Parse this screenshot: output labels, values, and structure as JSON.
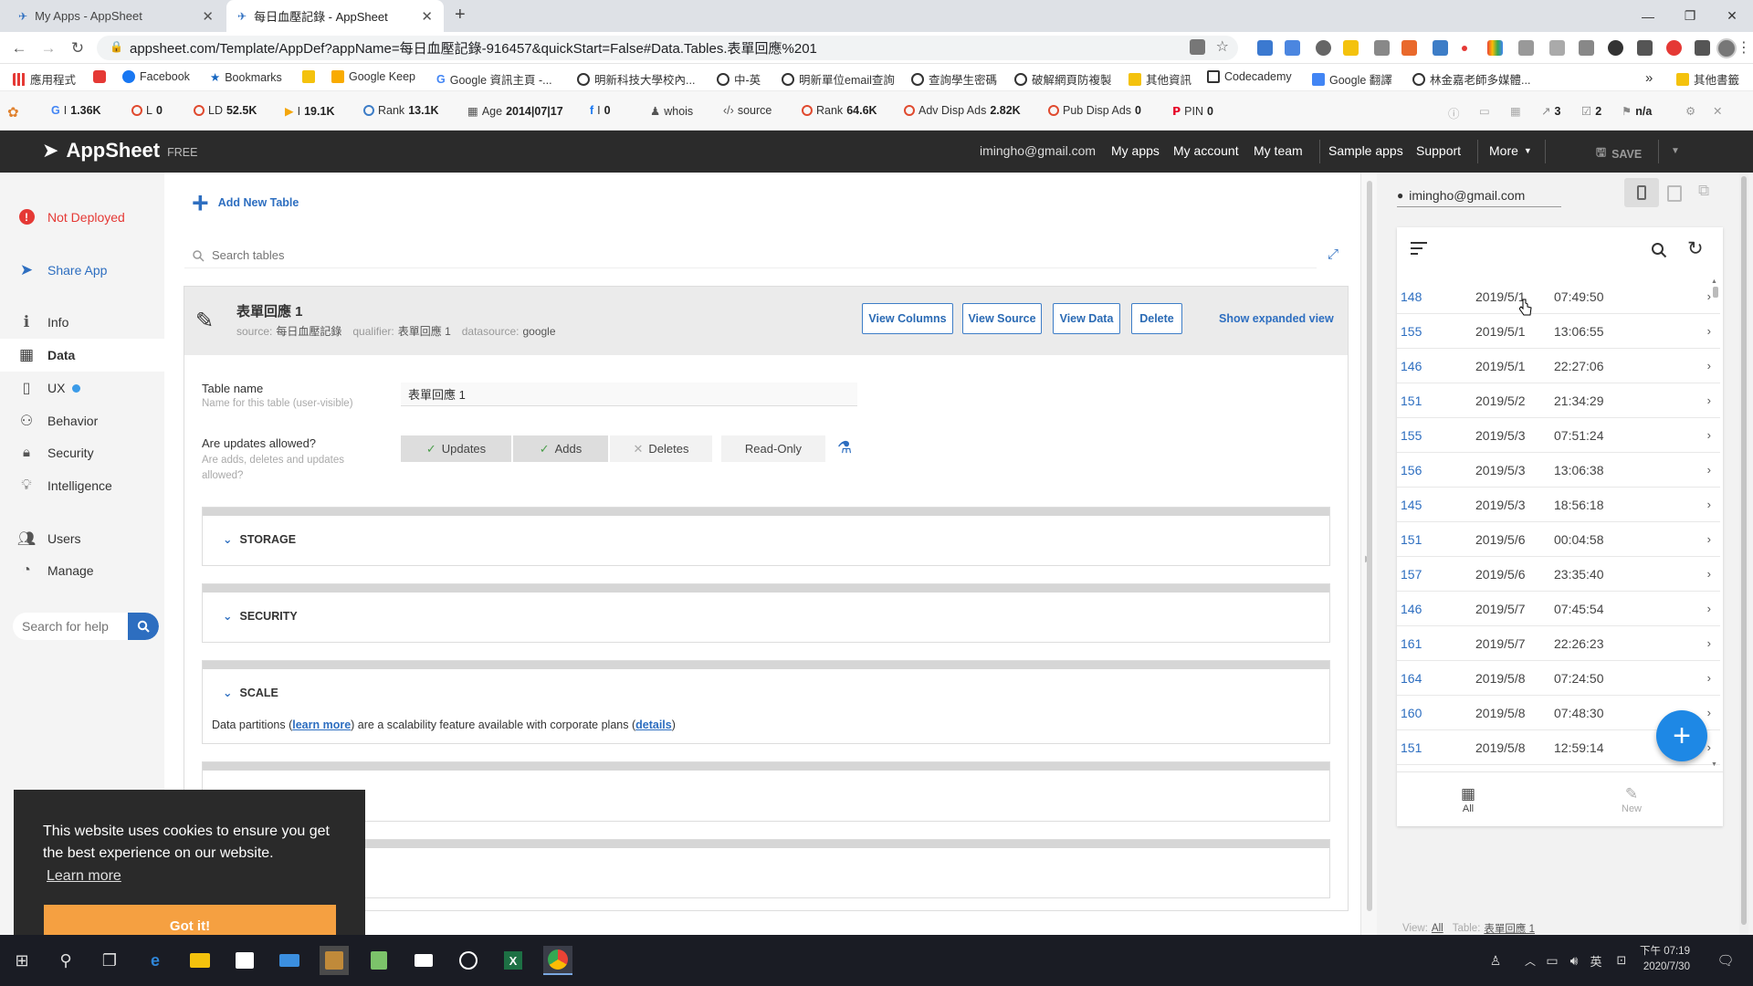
{
  "browser": {
    "tabs": [
      {
        "title": "My Apps - AppSheet",
        "active": false
      },
      {
        "title": "每日血壓記錄 - AppSheet",
        "active": true
      }
    ],
    "new_tab": "+",
    "url": "appsheet.com/Template/AppDef?appName=每日血壓記錄-916457&quickStart=False#Data.Tables.表單回應%201"
  },
  "bookmarks": [
    {
      "label": "應用程式",
      "icon": "apps-icon"
    },
    {
      "label": "",
      "icon": "youtube-icon"
    },
    {
      "label": "Facebook",
      "icon": "facebook-icon"
    },
    {
      "label": "Bookmarks",
      "icon": "star-icon"
    },
    {
      "label": "",
      "icon": "bookmark-yellow-icon"
    },
    {
      "label": "Google Keep",
      "icon": "keep-icon"
    },
    {
      "label": "Google 資訊主頁 -...",
      "icon": "google-icon"
    },
    {
      "label": "明新科技大學校內...",
      "icon": "globe-icon"
    },
    {
      "label": "中-英",
      "icon": "globe-icon"
    },
    {
      "label": "明新單位email查詢",
      "icon": "globe-icon"
    },
    {
      "label": "查詢學生密碼",
      "icon": "globe-icon"
    },
    {
      "label": "破解網頁防複製",
      "icon": "globe-icon"
    },
    {
      "label": "其他資訊",
      "icon": "folder-icon"
    },
    {
      "label": "Codecademy",
      "icon": "codecademy-icon"
    },
    {
      "label": "Google 翻譯",
      "icon": "translate-icon"
    },
    {
      "label": "林金嘉老師多媒體...",
      "icon": "globe-icon"
    },
    {
      "label": "»",
      "icon": ""
    },
    {
      "label": "其他書籤",
      "icon": "folder-icon"
    }
  ],
  "seobar": [
    {
      "prefix": "G",
      "label": "I",
      "value": "1.36K"
    },
    {
      "prefix": "",
      "label": "L",
      "value": "0"
    },
    {
      "prefix": "",
      "label": "LD",
      "value": "52.5K"
    },
    {
      "prefix": "",
      "label": "I",
      "value": "19.1K"
    },
    {
      "prefix": "",
      "label": "Rank",
      "value": "13.1K"
    },
    {
      "prefix": "",
      "label": "Age",
      "value": "2014|07|17"
    },
    {
      "prefix": "",
      "label": "I",
      "value": "0"
    },
    {
      "prefix": "",
      "label": "whois",
      "value": ""
    },
    {
      "prefix": "",
      "label": "source",
      "value": ""
    },
    {
      "prefix": "",
      "label": "Rank",
      "value": "64.6K"
    },
    {
      "prefix": "",
      "label": "Adv Disp Ads",
      "value": "2.82K"
    },
    {
      "prefix": "",
      "label": "Pub Disp Ads",
      "value": "0"
    },
    {
      "prefix": "",
      "label": "PIN",
      "value": "0"
    }
  ],
  "seobar_right": {
    "links": "3",
    "ext": "2",
    "na": "n/a"
  },
  "appsheet": {
    "brand": "AppSheet",
    "plan": "FREE",
    "email": "imingho@gmail.com",
    "links": [
      "My apps",
      "My account",
      "My team",
      "Sample apps",
      "Support",
      "More"
    ],
    "save": "SAVE"
  },
  "leftnav": {
    "status": "Not Deployed",
    "share": "Share App",
    "items": [
      "Info",
      "Data",
      "UX",
      "Behavior",
      "Security",
      "Intelligence",
      "Users",
      "Manage"
    ],
    "active": "Data",
    "search_placeholder": "Search for help"
  },
  "main": {
    "add_table": "Add New Table",
    "search_placeholder": "Search tables",
    "table": {
      "name": "表單回應 1",
      "source_label": "source:",
      "source": "每日血壓記錄",
      "qualifier_label": "qualifier:",
      "qualifier": "表單回應 1",
      "datasource_label": "datasource:",
      "datasource": "google",
      "buttons": [
        "View Columns",
        "View Source",
        "View Data",
        "Delete"
      ],
      "expanded": "Show expanded view"
    },
    "fields": {
      "table_name_label": "Table name",
      "table_name_hint": "Name for this table (user-visible)",
      "table_name_value": "表單回應 1",
      "updates_label": "Are updates allowed?",
      "updates_hint": "Are adds, deletes and updates allowed?",
      "options": [
        "Updates",
        "Adds",
        "Deletes",
        "Read-Only"
      ],
      "selected": [
        "Updates",
        "Adds"
      ]
    },
    "sections": [
      "STORAGE",
      "SECURITY",
      "SCALE"
    ],
    "scale_text": {
      "prefix": "Data partitions (",
      "learn": "learn more",
      "middle": ") are a scalability feature available with corporate plans (",
      "details": "details",
      "suffix": ")"
    }
  },
  "preview": {
    "user": "imingho@gmail.com",
    "rows": [
      {
        "id": "148",
        "date": "2019/5/1",
        "time": "07:49:50"
      },
      {
        "id": "155",
        "date": "2019/5/1",
        "time": "13:06:55"
      },
      {
        "id": "146",
        "date": "2019/5/1",
        "time": "22:27:06"
      },
      {
        "id": "151",
        "date": "2019/5/2",
        "time": "21:34:29"
      },
      {
        "id": "155",
        "date": "2019/5/3",
        "time": "07:51:24"
      },
      {
        "id": "156",
        "date": "2019/5/3",
        "time": "13:06:38"
      },
      {
        "id": "145",
        "date": "2019/5/3",
        "time": "18:56:18"
      },
      {
        "id": "151",
        "date": "2019/5/6",
        "time": "00:04:58"
      },
      {
        "id": "157",
        "date": "2019/5/6",
        "time": "23:35:40"
      },
      {
        "id": "146",
        "date": "2019/5/7",
        "time": "07:45:54"
      },
      {
        "id": "161",
        "date": "2019/5/7",
        "time": "22:26:23"
      },
      {
        "id": "164",
        "date": "2019/5/8",
        "time": "07:24:50"
      },
      {
        "id": "160",
        "date": "2019/5/8",
        "time": "07:48:30"
      },
      {
        "id": "151",
        "date": "2019/5/8",
        "time": "12:59:14"
      }
    ],
    "bottom_tabs": [
      "All",
      "New"
    ],
    "view_label": "View:",
    "view_value": "All",
    "table_label": "Table:",
    "table_value": "表單回應 1"
  },
  "cookie": {
    "text": "This website uses cookies to ensure you get the best experience on our website.",
    "learn": "Learn more",
    "button": "Got it!"
  },
  "taskbar": {
    "time": "下午 07:19",
    "date": "2020/7/30",
    "ime": "英"
  },
  "colors": {
    "accent": "#2d6ec0",
    "header": "#2b2b2b",
    "fab": "#1e88e5",
    "cookie_btn": "#f5a041",
    "error": "#e53935"
  }
}
